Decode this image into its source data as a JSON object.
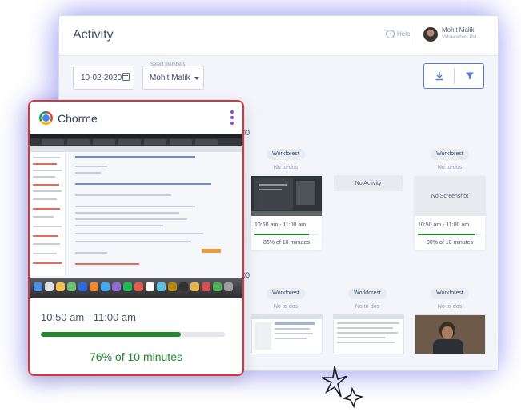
{
  "header": {
    "title": "Activity",
    "help_label": "Help",
    "user_name": "Mohit Malik",
    "user_org": "Valuecoders Pvt..."
  },
  "filters": {
    "date": "10-02-2020",
    "members_label": "Select members",
    "member_selected": "Mohit Malik"
  },
  "time_heading_1": "00",
  "time_heading_2": "00",
  "row1": [
    {
      "project": "Workforest",
      "todo": "No to-dos",
      "time": "10:50 am - 11:00 am",
      "activity_pct": 86,
      "activity": "86% of 10 minutes"
    },
    {
      "empty_label": "No Activity"
    },
    {
      "project": "Workforest",
      "todo": "No to-dos",
      "empty_label": "No Screenshot",
      "time": "10:50 am - 11:00 am",
      "activity_pct": 90,
      "activity": "90% of 10 minutes"
    }
  ],
  "row2": [
    {
      "project": "Workforest",
      "todo": "No to-dos"
    },
    {
      "project": "Workforest",
      "todo": "No to-dos"
    },
    {
      "project": "Workforest",
      "todo": "No to-dos"
    }
  ],
  "popup": {
    "app_name": "Chorme",
    "time": "10:50 am - 11:00 am",
    "activity_pct": 76,
    "activity": "76% of 10 minutes"
  },
  "colors": {
    "accent": "#5a7bd4",
    "progress": "#1f8a2b",
    "popup_border": "#d9333f",
    "menu_dots": "#8a4ad6"
  }
}
